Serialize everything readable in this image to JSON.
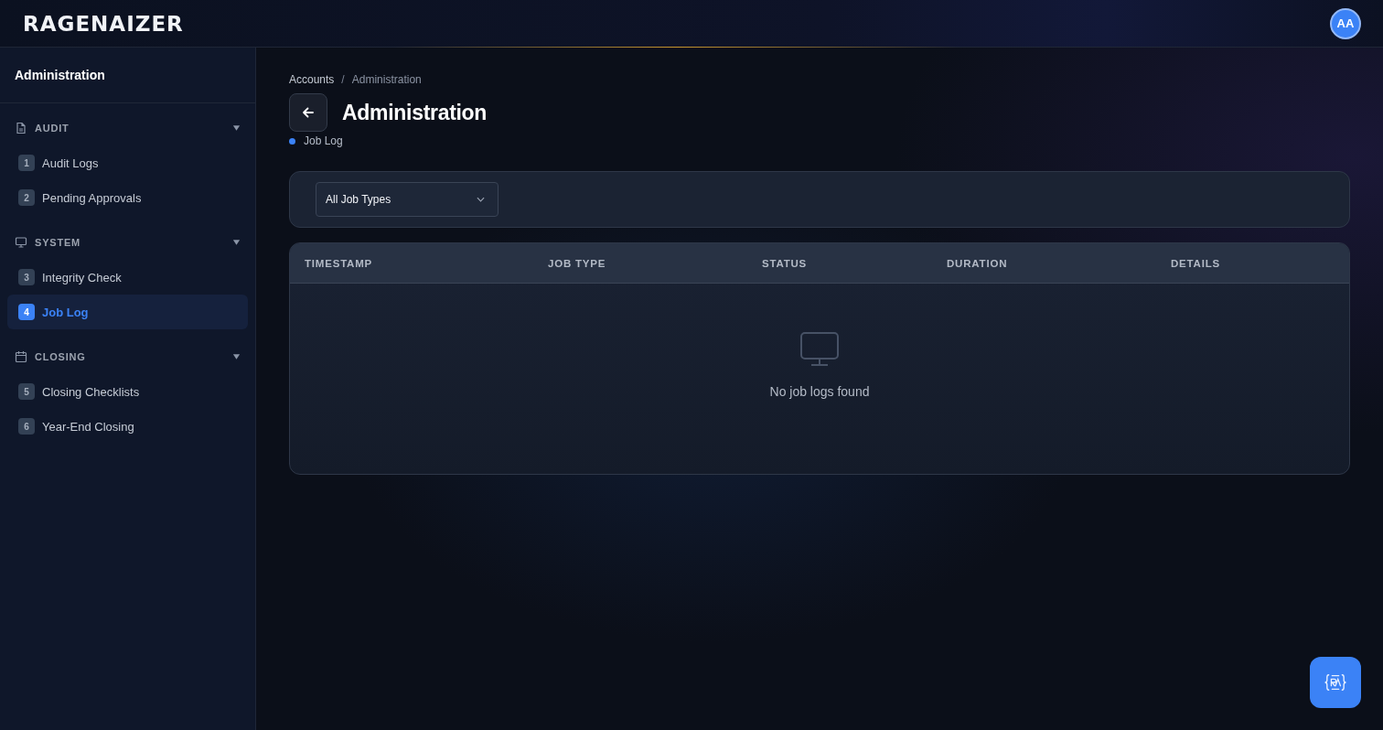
{
  "header": {
    "logo": "RAGENAIZER",
    "avatar": "AA"
  },
  "sidebar": {
    "title": "Administration",
    "sections": [
      {
        "label": "AUDIT",
        "expanded": true,
        "items": [
          {
            "number": "1",
            "label": "Audit Logs",
            "selected": false
          },
          {
            "number": "2",
            "label": "Pending Approvals",
            "selected": false
          }
        ]
      },
      {
        "label": "SYSTEM",
        "expanded": true,
        "items": [
          {
            "number": "3",
            "label": "Integrity Check",
            "selected": false
          },
          {
            "number": "4",
            "label": "Job Log",
            "selected": true
          }
        ]
      },
      {
        "label": "CLOSING",
        "expanded": true,
        "items": [
          {
            "number": "5",
            "label": "Closing Checklists",
            "selected": false
          },
          {
            "number": "6",
            "label": "Year-End Closing",
            "selected": false
          }
        ]
      }
    ]
  },
  "breadcrumb": {
    "separator": "/",
    "items": [
      "Accounts",
      "Administration"
    ]
  },
  "page": {
    "title": "Administration",
    "subtitle": "Job Log"
  },
  "filter": {
    "value": "All Job Types"
  },
  "table": {
    "columns": [
      "TIMESTAMP",
      "JOB TYPE",
      "STATUS",
      "DURATION",
      "DETAILS"
    ],
    "empty_message": "No job logs found"
  }
}
